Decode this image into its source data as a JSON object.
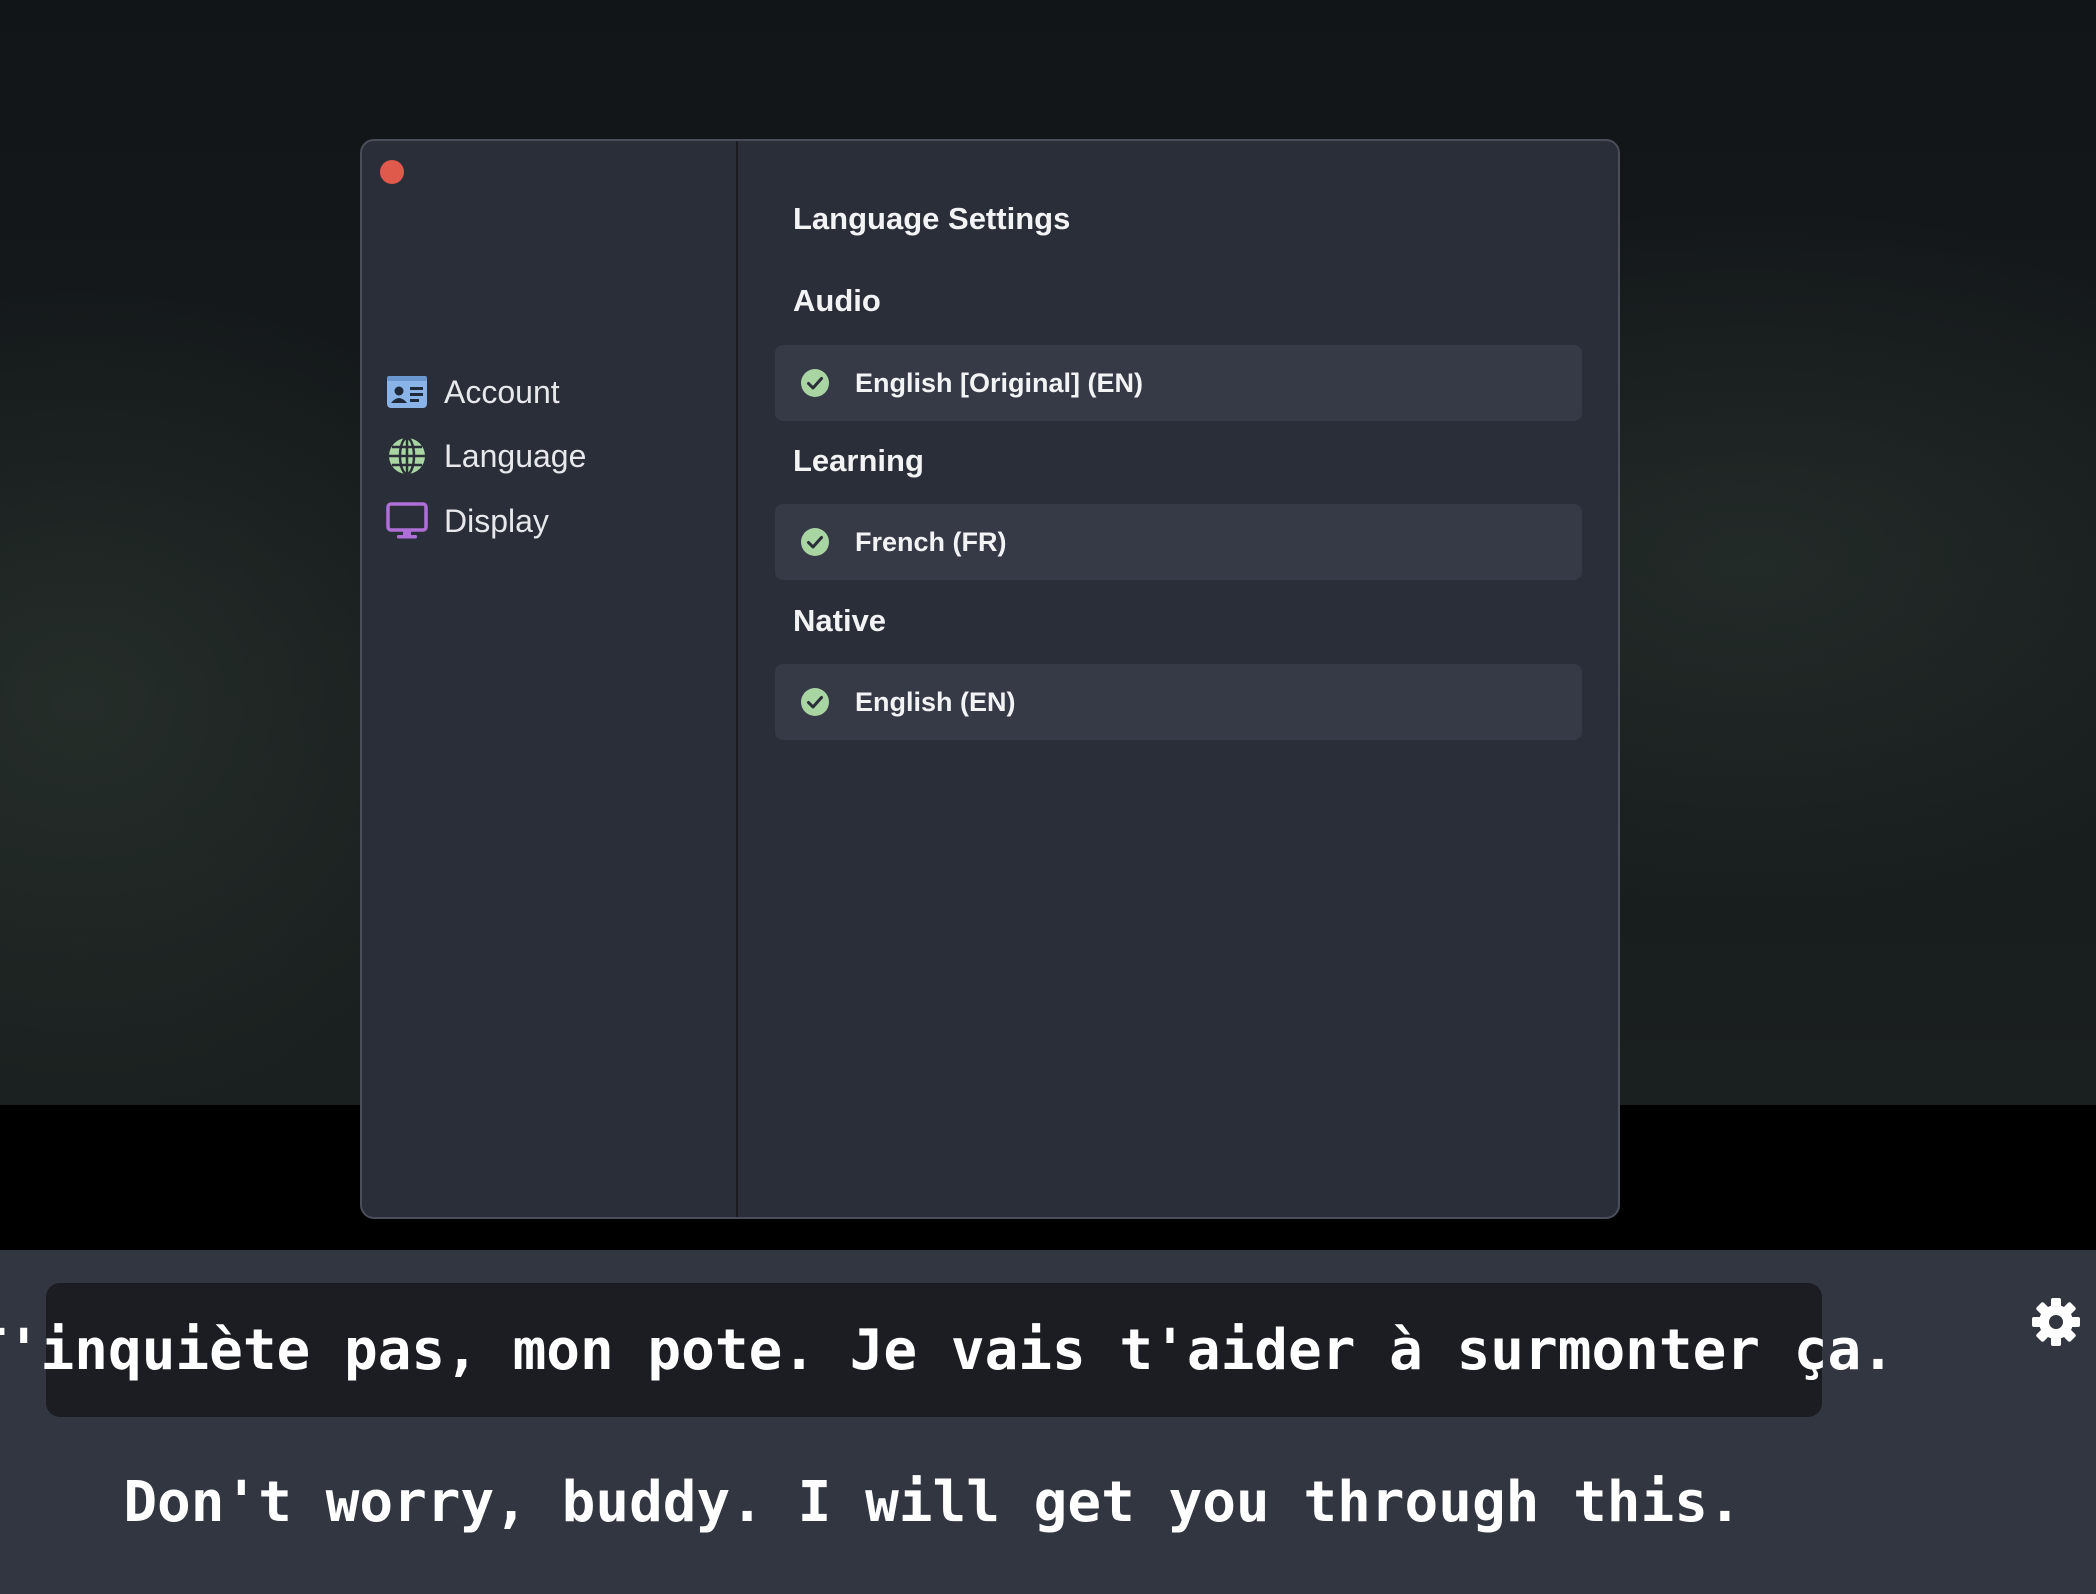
{
  "window": {
    "sidebar": {
      "items": [
        {
          "label": "Account",
          "icon": "account-card-icon",
          "color": "#8ab4e8"
        },
        {
          "label": "Language",
          "icon": "globe-icon",
          "color": "#a8d5a2"
        },
        {
          "label": "Display",
          "icon": "monitor-icon",
          "color": "#b06fd8"
        }
      ]
    },
    "content": {
      "title": "Language Settings",
      "sections": [
        {
          "heading": "Audio",
          "selected": "English [Original] (EN)"
        },
        {
          "heading": "Learning",
          "selected": "French (FR)"
        },
        {
          "heading": "Native",
          "selected": "English (EN)"
        }
      ]
    }
  },
  "subtitles": {
    "foreign": "T'inquiète pas, mon pote. Je vais t'aider à surmonter ça.",
    "translation": "Don't worry, buddy. I will get you through this."
  },
  "colors": {
    "accent_check": "#a8d5a2",
    "close": "#e05a4b"
  }
}
